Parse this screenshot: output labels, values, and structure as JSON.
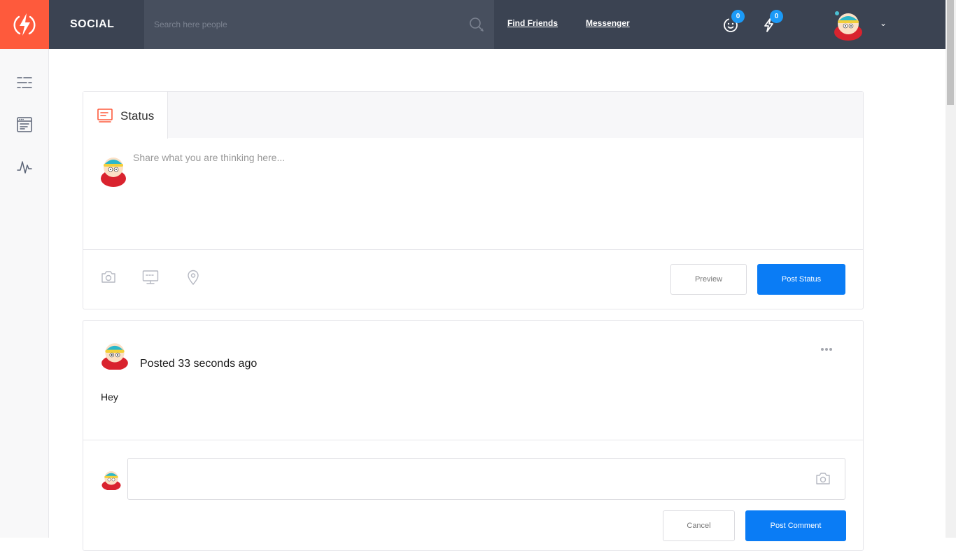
{
  "app": {
    "brand": "SOCIAL",
    "accent_color": "#fe5a3c",
    "primary_color": "#0a7cf5",
    "topbar_color": "#3b4352"
  },
  "header": {
    "search": {
      "placeholder": "Search here people",
      "value": ""
    },
    "nav": [
      {
        "label": "Find Friends"
      },
      {
        "label": "Messenger"
      }
    ],
    "friend_requests": {
      "icon": "smiley-icon",
      "count": "0"
    },
    "notifications": {
      "icon": "bolt-notification-icon",
      "count": "0"
    },
    "user_menu_caret": "⌄"
  },
  "sidebar": {
    "items": [
      {
        "icon": "feed-list-icon"
      },
      {
        "icon": "browser-window-icon"
      },
      {
        "icon": "activity-pulse-icon"
      }
    ]
  },
  "composer": {
    "tab_label": "Status",
    "placeholder": "Share what you are thinking here...",
    "value": "",
    "tools": [
      "camera-icon",
      "monitor-icon",
      "location-pin-icon"
    ],
    "preview_label": "Preview",
    "post_label": "Post Status"
  },
  "post": {
    "meta": "Posted 33 seconds ago",
    "body": "Hey",
    "comment": {
      "value": "",
      "cancel_label": "Cancel",
      "post_label": "Post Comment"
    }
  }
}
